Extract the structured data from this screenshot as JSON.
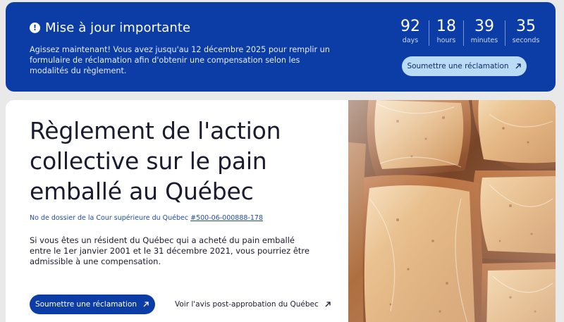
{
  "banner": {
    "title": "Mise à jour importante",
    "text": "Agissez maintenant! Vous avez jusqu'au 12 décembre 2025 pour remplir un formulaire de réclamation afin d'obtenir une compensation selon les modalités du règlement.",
    "countdown": [
      {
        "value": "92",
        "label": "days"
      },
      {
        "value": "18",
        "label": "hours"
      },
      {
        "value": "39",
        "label": "minutes"
      },
      {
        "value": "35",
        "label": "seconds"
      }
    ],
    "button_label": "Soumettre une réclamation",
    "icon": "exclamation-circle-icon"
  },
  "hero": {
    "title": "Règlement de l'action collective sur le pain emballé au Québec",
    "docket_prefix": "No de dossier de la Cour supérieure du Québec",
    "docket_number": "#500-06-000888-178",
    "description": "Si vous êtes un résident du Québec qui a acheté du pain emballé entre le 1er janvier 2001 et le 31 décembre 2021, vous pourriez être admissible à une compensation.",
    "primary_button": "Soumettre une réclamation",
    "secondary_link": "Voir l'avis post-approbation du Québec"
  },
  "colors": {
    "brand_blue": "#0c3da6",
    "light_blue_button": "#b9dbf5"
  }
}
